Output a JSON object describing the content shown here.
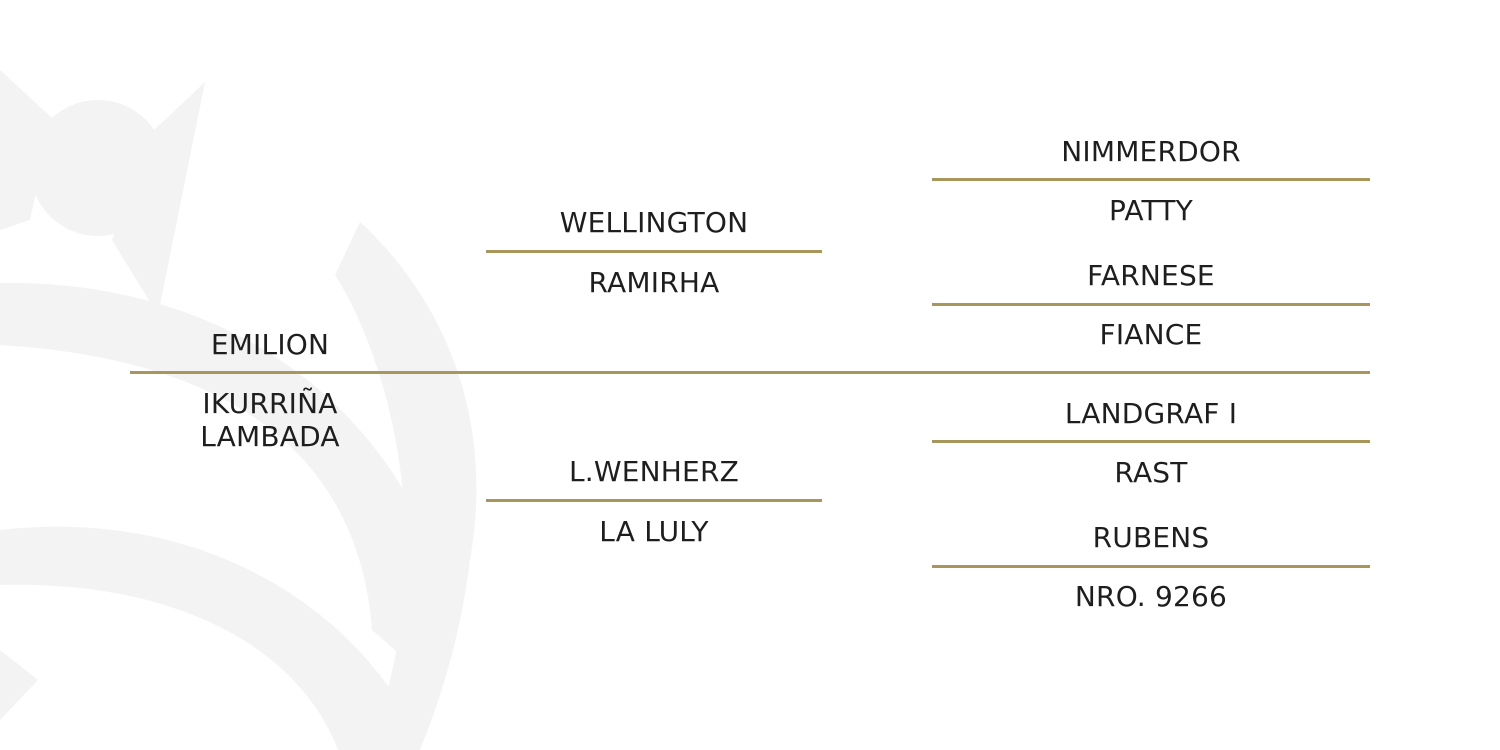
{
  "pedigree": {
    "sire": "EMILION",
    "dam": "IKURRIÑA LAMBADA",
    "sire_sire": "WELLINGTON",
    "sire_dam": "RAMIRHA",
    "dam_sire": "L.WENHERZ",
    "dam_dam": "LA LULY",
    "sire_sire_sire": "NIMMERDOR",
    "sire_sire_dam": "PATTY",
    "sire_dam_sire": "FARNESE",
    "sire_dam_dam": "FIANCE",
    "dam_sire_sire": "LANDGRAF I",
    "dam_sire_dam": "RAST",
    "dam_dam_sire": "RUBENS",
    "dam_dam_dam": "NRO. 9266"
  },
  "colors": {
    "line": "#a8965a",
    "text": "#1e1e1e",
    "watermark": "#f3f3f3"
  },
  "icons": {
    "watermark": "crown-arc-watermark-icon"
  }
}
